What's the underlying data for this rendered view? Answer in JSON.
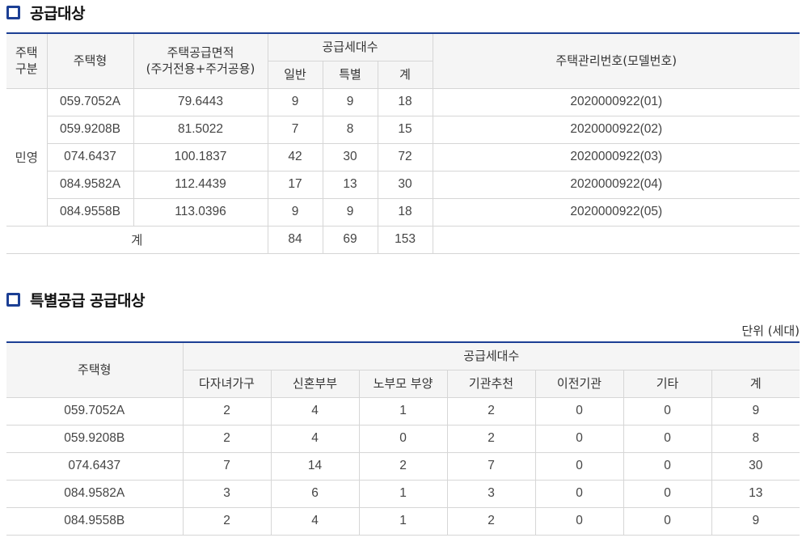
{
  "section1": {
    "title": "공급대상"
  },
  "supply_table": {
    "headers": {
      "type_category_line1": "주택",
      "type_category_line2": "구분",
      "house_type": "주택형",
      "area_line1": "주택공급면적",
      "area_line2": "(주거전용+주거공용)",
      "units_group": "공급세대수",
      "general": "일반",
      "special": "특별",
      "total": "계",
      "model_no": "주택관리번호(모델번호)"
    },
    "category": "민영",
    "rows": [
      {
        "type": "059.7052A",
        "area": "79.6443",
        "general": "9",
        "special": "9",
        "total": "18",
        "model": "2020000922(01)"
      },
      {
        "type": "059.9208B",
        "area": "81.5022",
        "general": "7",
        "special": "8",
        "total": "15",
        "model": "2020000922(02)"
      },
      {
        "type": "074.6437",
        "area": "100.1837",
        "general": "42",
        "special": "30",
        "total": "72",
        "model": "2020000922(03)"
      },
      {
        "type": "084.9582A",
        "area": "112.4439",
        "general": "17",
        "special": "13",
        "total": "30",
        "model": "2020000922(04)"
      },
      {
        "type": "084.9558B",
        "area": "113.0396",
        "general": "9",
        "special": "9",
        "total": "18",
        "model": "2020000922(05)"
      }
    ],
    "sum": {
      "label": "계",
      "general": "84",
      "special": "69",
      "total": "153"
    }
  },
  "section2": {
    "title": "특별공급 공급대상",
    "unit": "단위 (세대)"
  },
  "special_table": {
    "headers": {
      "house_type": "주택형",
      "units_group": "공급세대수",
      "multi_child": "다자녀가구",
      "newlywed": "신혼부부",
      "elderly_parent": "노부모 부양",
      "institution": "기관추천",
      "relocated": "이전기관",
      "other": "기타",
      "total": "계"
    },
    "rows": [
      {
        "type": "059.7052A",
        "multi_child": "2",
        "newlywed": "4",
        "elderly_parent": "1",
        "institution": "2",
        "relocated": "0",
        "other": "0",
        "total": "9"
      },
      {
        "type": "059.9208B",
        "multi_child": "2",
        "newlywed": "4",
        "elderly_parent": "0",
        "institution": "2",
        "relocated": "0",
        "other": "0",
        "total": "8"
      },
      {
        "type": "074.6437",
        "multi_child": "7",
        "newlywed": "14",
        "elderly_parent": "2",
        "institution": "7",
        "relocated": "0",
        "other": "0",
        "total": "30"
      },
      {
        "type": "084.9582A",
        "multi_child": "3",
        "newlywed": "6",
        "elderly_parent": "1",
        "institution": "3",
        "relocated": "0",
        "other": "0",
        "total": "13"
      },
      {
        "type": "084.9558B",
        "multi_child": "2",
        "newlywed": "4",
        "elderly_parent": "1",
        "institution": "2",
        "relocated": "0",
        "other": "0",
        "total": "9"
      }
    ]
  },
  "colors": {
    "accent": "#1c3f94",
    "header_bg": "#f5f5f5",
    "border": "#d6d6d6"
  }
}
